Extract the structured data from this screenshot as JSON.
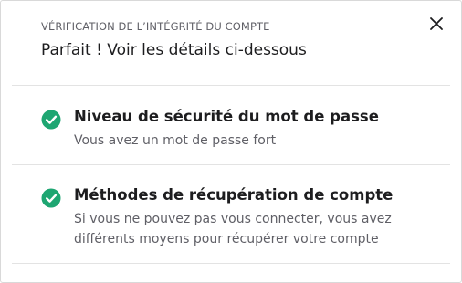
{
  "dialog": {
    "eyebrow": "VÉRIFICATION DE L’INTÉGRITÉ DU COMPTE",
    "title": "Parfait ! Voir les détails ci-dessous",
    "close_icon": "close-icon",
    "accent_color": "#1ea672"
  },
  "checks": [
    {
      "icon": "check-circle-icon",
      "status": "ok",
      "title": "Niveau de sécurité du mot de passe",
      "description": "Vous avez un mot de passe fort"
    },
    {
      "icon": "check-circle-icon",
      "status": "ok",
      "title": "Méthodes de récupération de compte",
      "description": "Si vous ne pouvez pas vous connecter, vous avez différents moyens pour récupérer votre compte"
    }
  ]
}
